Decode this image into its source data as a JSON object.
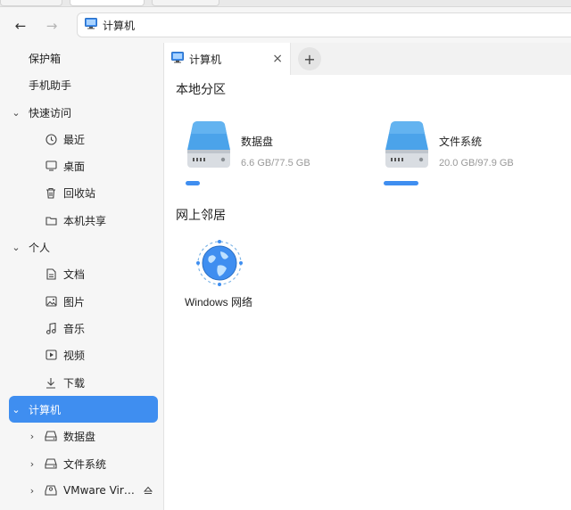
{
  "address_bar": {
    "back_label": "←",
    "forward_label": "→",
    "path": "计算机"
  },
  "sidebar": {
    "items": [
      {
        "label": "保护箱"
      },
      {
        "label": "手机助手"
      },
      {
        "label": "快速访问"
      },
      {
        "label": "最近"
      },
      {
        "label": "桌面"
      },
      {
        "label": "回收站"
      },
      {
        "label": "本机共享"
      },
      {
        "label": "个人"
      },
      {
        "label": "文档"
      },
      {
        "label": "图片"
      },
      {
        "label": "音乐"
      },
      {
        "label": "视频"
      },
      {
        "label": "下载"
      },
      {
        "label": "计算机"
      },
      {
        "label": "数据盘"
      },
      {
        "label": "文件系统"
      },
      {
        "label": "VMware Virt…"
      }
    ]
  },
  "tabs": {
    "active": {
      "label": "计算机",
      "close": "×"
    },
    "new_tab": "+"
  },
  "main": {
    "local_title": "本地分区",
    "drives": [
      {
        "name": "数据盘",
        "size": "6.6 GB/77.5 GB",
        "usage": 0.085
      },
      {
        "name": "文件系统",
        "size": "20.0 GB/97.9 GB",
        "usage": 0.204
      }
    ],
    "network_title": "网上邻居",
    "network_item": "Windows 网络"
  },
  "colors": {
    "accent": "#3f8ef0",
    "drive_blue": "#4ba3ea"
  }
}
